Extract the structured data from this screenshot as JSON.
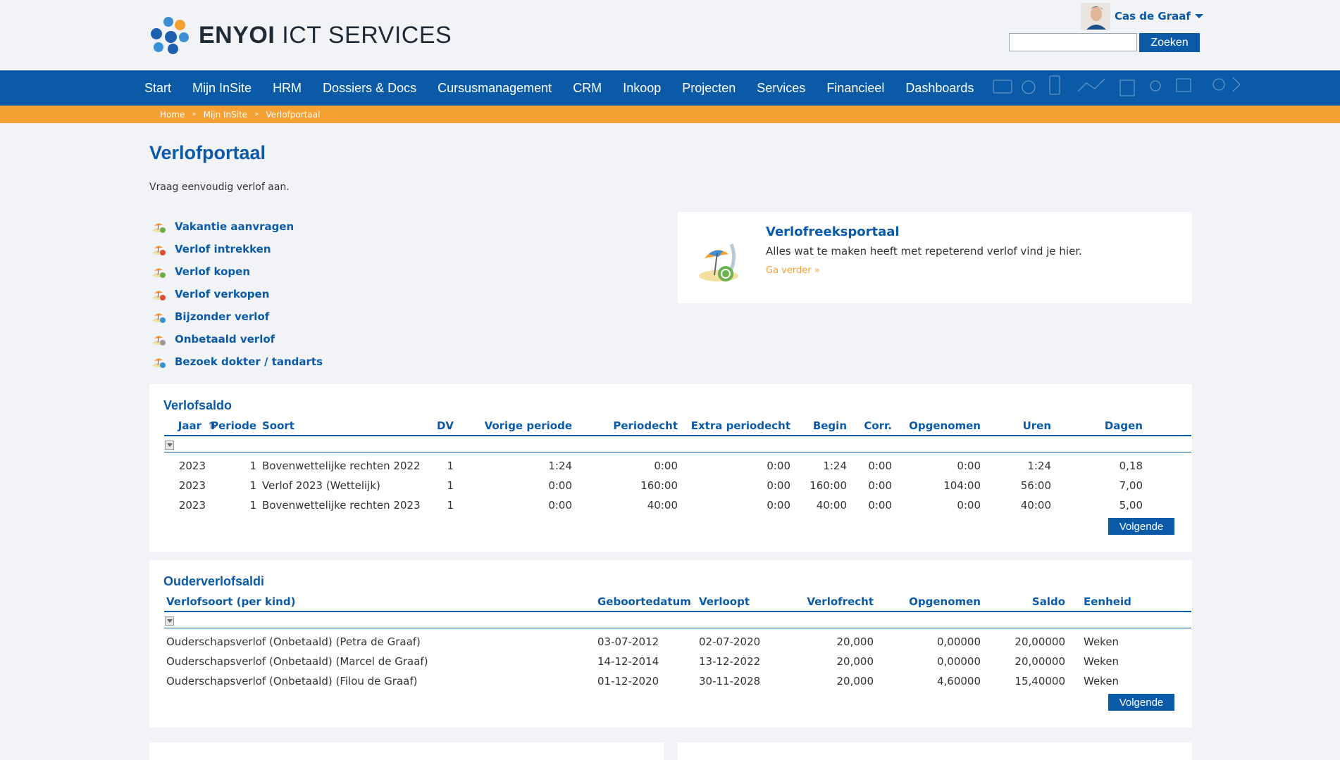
{
  "brand": {
    "bold": "ENYOI",
    "light": "ICT SERVICES"
  },
  "user": {
    "name": "Cas de Graaf"
  },
  "search": {
    "placeholder": "",
    "button": "Zoeken"
  },
  "nav": [
    "Start",
    "Mijn InSite",
    "HRM",
    "Dossiers & Docs",
    "Cursusmanagement",
    "CRM",
    "Inkoop",
    "Projecten",
    "Services",
    "Financieel",
    "Dashboards"
  ],
  "breadcrumbs": [
    "Home",
    "Mijn InSite",
    "Verlofportaal"
  ],
  "breadcrumb_sep": "»",
  "page": {
    "title": "Verlofportaal",
    "subtitle": "Vraag eenvoudig verlof aan."
  },
  "links": [
    "Vakantie aanvragen",
    "Verlof intrekken",
    "Verlof kopen",
    "Verlof verkopen",
    "Bijzonder verlof",
    "Onbetaald verlof",
    "Bezoek dokter / tandarts"
  ],
  "link_icons": [
    "vacation-request-icon",
    "leave-withdraw-icon",
    "leave-buy-icon",
    "leave-sell-icon",
    "special-leave-icon",
    "unpaid-leave-icon",
    "stethoscope-icon"
  ],
  "promo": {
    "title": "Verlofreeksportaal",
    "text": "Alles wat te maken heeft met repeterend verlof vind je hier.",
    "link": "Ga verder »"
  },
  "verlofsaldo": {
    "title": "Verlofsaldo",
    "headers": [
      "Jaar",
      "Periode",
      "Soort",
      "DV",
      "Vorige periode",
      "Periodecht",
      "Extra periodecht",
      "Begin",
      "Corr.",
      "Opgenomen",
      "Uren",
      "Dagen"
    ],
    "rows": [
      [
        "2023",
        "1",
        "Bovenwettelijke rechten 2022",
        "1",
        "1:24",
        "0:00",
        "0:00",
        "1:24",
        "0:00",
        "0:00",
        "1:24",
        "0,18"
      ],
      [
        "2023",
        "1",
        "Verlof 2023 (Wettelijk)",
        "1",
        "0:00",
        "160:00",
        "0:00",
        "160:00",
        "0:00",
        "104:00",
        "56:00",
        "7,00"
      ],
      [
        "2023",
        "1",
        "Bovenwettelijke rechten 2023",
        "1",
        "0:00",
        "40:00",
        "0:00",
        "40:00",
        "0:00",
        "0:00",
        "40:00",
        "5,00"
      ]
    ],
    "next": "Volgende"
  },
  "ouderverlof": {
    "title": "Ouderverlofsaldi",
    "headers": [
      "Verlofsoort (per kind)",
      "Geboortedatum",
      "Verloopt",
      "Verlofrecht",
      "Opgenomen",
      "Saldo",
      "Eenheid"
    ],
    "rows": [
      [
        "Ouderschapsverlof (Onbetaald) (Petra de Graaf)",
        "03-07-2012",
        "02-07-2020",
        "20,000",
        "0,00000",
        "20,00000",
        "Weken"
      ],
      [
        "Ouderschapsverlof (Onbetaald) (Marcel de Graaf)",
        "14-12-2014",
        "13-12-2022",
        "20,000",
        "0,00000",
        "20,00000",
        "Weken"
      ],
      [
        "Ouderschapsverlof (Onbetaald) (Filou de Graaf)",
        "01-12-2020",
        "30-11-2028",
        "20,000",
        "4,60000",
        "15,40000",
        "Weken"
      ]
    ],
    "next": "Volgende"
  },
  "colors": {
    "primary": "#0a5aa7",
    "accent": "#f5a033",
    "background": "#f1f3f6"
  }
}
